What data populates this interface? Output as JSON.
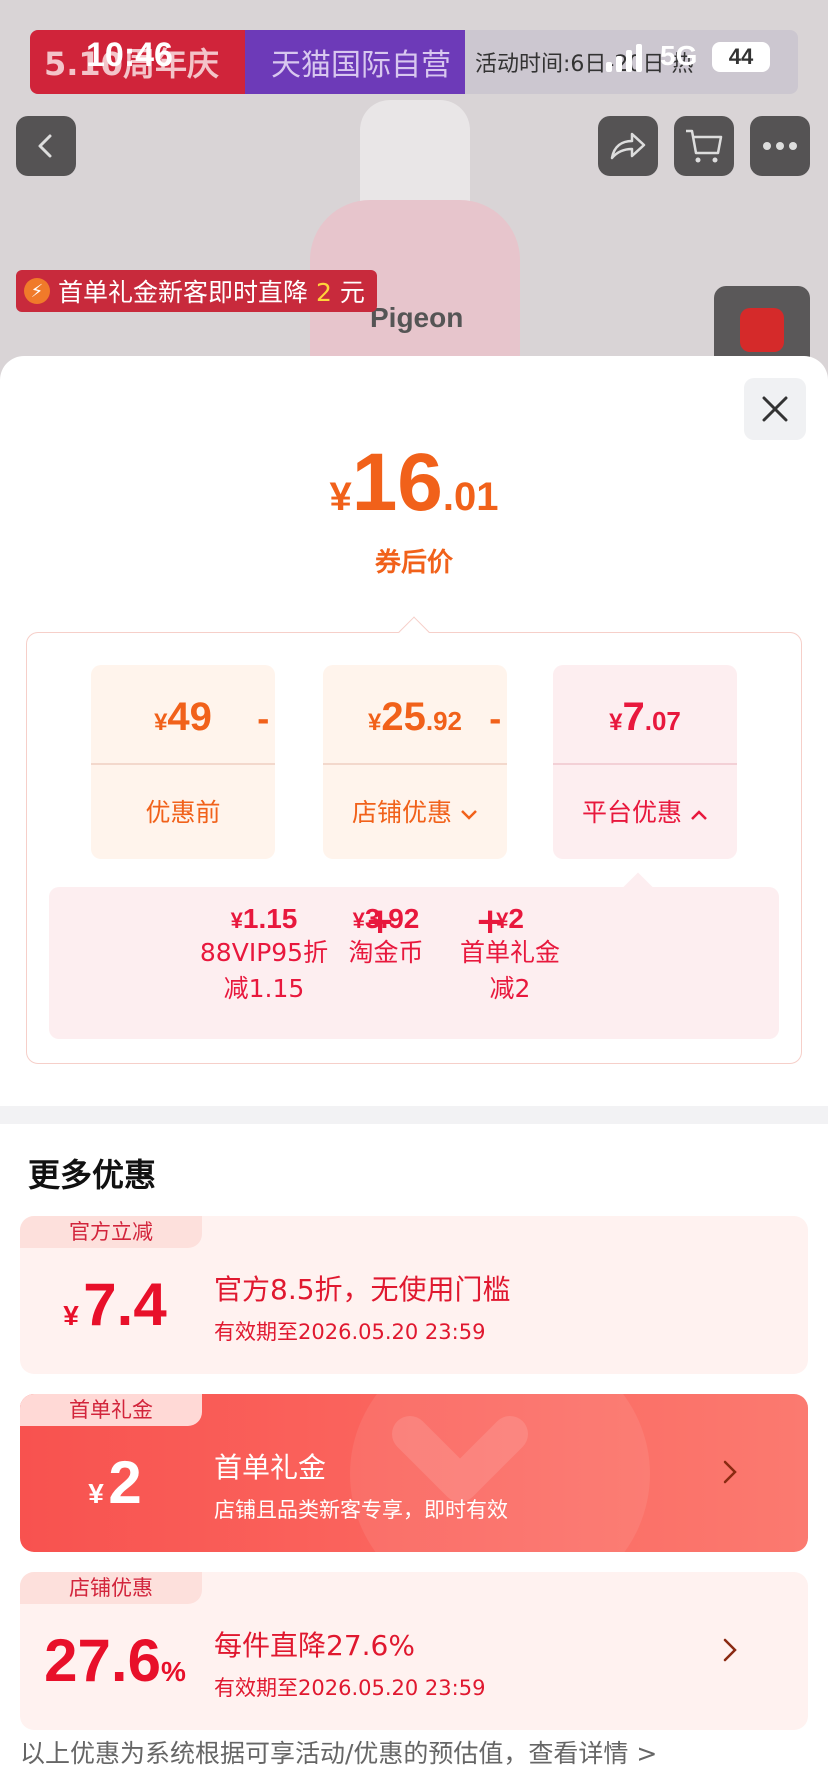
{
  "status_bar": {
    "time": "10:46",
    "network": "5G",
    "battery": "44"
  },
  "banner": {
    "promo": "5.10周年庆",
    "store_type": "天猫国际自营",
    "activity_time": "活动时间:6日-20日 热"
  },
  "product": {
    "brand": "Pigeon"
  },
  "promo_tag": {
    "text": "首单礼金新客即时直降",
    "amount": "2",
    "unit": "元"
  },
  "price_summary": {
    "currency": "¥",
    "final_int": "16",
    "final_dec": ".01",
    "final_label": "券后价",
    "original": {
      "currency": "¥",
      "int": "49",
      "dec": "",
      "label": "优惠前"
    },
    "store_discount": {
      "currency": "¥",
      "int": "25",
      "dec": ".92",
      "label": "店铺优惠"
    },
    "platform_discount": {
      "currency": "¥",
      "int": "7",
      "dec": ".07",
      "label": "平台优惠"
    },
    "minus": "-",
    "plus": "+",
    "platform_items": [
      {
        "currency": "¥",
        "amount": "1.15",
        "line1": "88VIP95折",
        "line2": "减1.15"
      },
      {
        "currency": "¥",
        "amount": "3.92",
        "line1": "淘金币",
        "line2": ""
      },
      {
        "currency": "¥",
        "amount": "2",
        "line1": "首单礼金",
        "line2": "减2"
      }
    ]
  },
  "more_offers": {
    "title": "更多优惠",
    "coupons": [
      {
        "tag": "官方立减",
        "currency": "¥",
        "amount": "7.4",
        "suffix": "",
        "title": "官方8.5折，无使用门槛",
        "desc": "有效期至2026.05.20 23:59"
      },
      {
        "tag": "首单礼金",
        "currency": "¥",
        "amount": "2",
        "suffix": "",
        "title": "首单礼金",
        "desc": "店铺且品类新客专享，即时有效"
      },
      {
        "tag": "店铺优惠",
        "currency": "",
        "amount": "27.6",
        "suffix": "%",
        "title": "每件直降27.6%",
        "desc": "有效期至2026.05.20 23:59"
      }
    ]
  },
  "footer": {
    "note": "以上优惠为系统根据可享活动/优惠的预估值，查看详情 >"
  },
  "colors": {
    "accent_orange": "#f1611a",
    "accent_red": "#e8183d",
    "coupon_red": "#f8524f"
  },
  "icons": [
    "back-icon",
    "share-icon",
    "cart-icon",
    "more-icon",
    "close-icon",
    "chevron-down-icon",
    "chevron-up-icon",
    "chevron-right-icon",
    "bolt-icon"
  ]
}
